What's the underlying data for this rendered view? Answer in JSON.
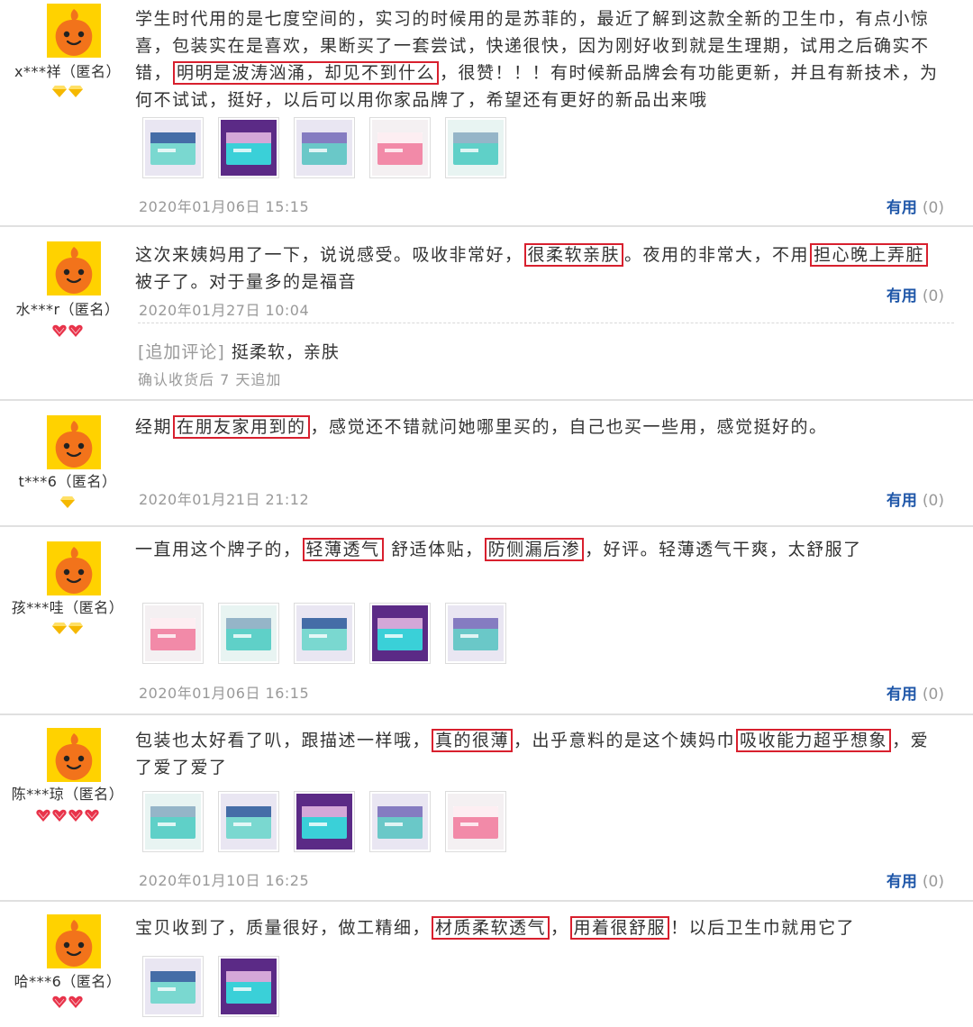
{
  "reviews": [
    {
      "username": "x***祥（匿名）",
      "badge": "yellow-diamond",
      "badge_count": 2,
      "text_parts": [
        {
          "t": "学生时代用的是七度空间的，实习的时候用的是苏菲的，最近了解到这款全新的卫生巾，有点小惊喜，包装实在是喜欢，果断买了一套尝试，快递很快，因为刚好收到就是生理期，试用之后确实不错，"
        },
        {
          "t": "明明是波涛汹涌，却见不到什么",
          "hl": true
        },
        {
          "t": "，很赞！！！有时候新品牌会有功能更新，并且有新技术，为何不试试，挺好，以后可以用你家品牌了，希望还有更好的新品出来哦"
        }
      ],
      "photos": 5,
      "date": "2020年01月06日 15:15",
      "helpful_label": "有用",
      "helpful_count": "(0)"
    },
    {
      "username": "水***r（匿名）",
      "badge": "red-diamond",
      "badge_count": 2,
      "text_parts": [
        {
          "t": "这次来姨妈用了一下，说说感受。吸收非常好，"
        },
        {
          "t": "很柔软亲肤",
          "hl": true
        },
        {
          "t": "。夜用的非常大，不用"
        },
        {
          "t": "担心晚上弄脏",
          "hl": true
        },
        {
          "t": "被子了。对于量多的是福音"
        }
      ],
      "photos": 0,
      "date": "2020年01月27日 10:04",
      "helpful_label": "有用",
      "helpful_count": "(0)",
      "append_label": "[追加评论]",
      "append_text": "挺柔软，亲肤",
      "append_sub": "确认收货后 7 天追加"
    },
    {
      "username": "t***6（匿名）",
      "badge": "yellow-diamond",
      "badge_count": 1,
      "text_parts": [
        {
          "t": "经期"
        },
        {
          "t": "在朋友家用到的",
          "hl": true
        },
        {
          "t": "，感觉还不错就问她哪里买的，自己也买一些用，感觉挺好的。"
        }
      ],
      "photos": 0,
      "date": "2020年01月21日 21:12",
      "helpful_label": "有用",
      "helpful_count": "(0)"
    },
    {
      "username": "孩***哇（匿名）",
      "badge": "yellow-diamond",
      "badge_count": 2,
      "text_parts": [
        {
          "t": "一直用这个牌子的，"
        },
        {
          "t": "轻薄透气",
          "hl": true
        },
        {
          "t": "  舒适体贴，"
        },
        {
          "t": "防侧漏后渗",
          "hl": true
        },
        {
          "t": "，好评。轻薄透气干爽，太舒服了"
        }
      ],
      "photos": 5,
      "date": "2020年01月06日 16:15",
      "helpful_label": "有用",
      "helpful_count": "(0)"
    },
    {
      "username": "陈***琼（匿名）",
      "badge": "red-diamond",
      "badge_count": 4,
      "text_parts": [
        {
          "t": "包装也太好看了叭，跟描述一样哦，"
        },
        {
          "t": "真的很薄",
          "hl": true
        },
        {
          "t": "，出乎意料的是这个姨妈巾"
        },
        {
          "t": "吸收能力超乎想象",
          "hl": true
        },
        {
          "t": "，爱了爱了爱了"
        }
      ],
      "photos": 5,
      "date": "2020年01月10日 16:25",
      "helpful_label": "有用",
      "helpful_count": "(0)"
    },
    {
      "username": "哈***6（匿名）",
      "badge": "red-diamond",
      "badge_count": 2,
      "text_parts": [
        {
          "t": "宝贝收到了，质量很好，做工精细，"
        },
        {
          "t": "材质柔软透气",
          "hl": true
        },
        {
          "t": "，"
        },
        {
          "t": "用着很舒服",
          "hl": true
        },
        {
          "t": "！以后卫生巾就用它了"
        }
      ],
      "photos": 2
    }
  ],
  "colors": {
    "helpful_blue": "#1e56a8",
    "highlight_red": "#d8202e",
    "date_gray": "#999999",
    "avatar_orange": "#f2731b",
    "avatar_yellow": "#ffd200"
  }
}
